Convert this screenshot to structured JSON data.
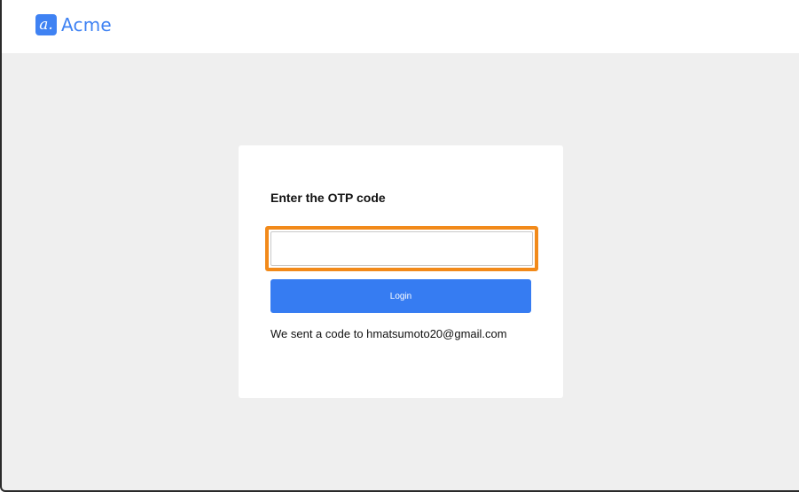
{
  "brand": {
    "logo_glyph": "a.",
    "name": "Acme",
    "color": "#3f82f3"
  },
  "otp": {
    "title": "Enter the OTP code",
    "input_value": "",
    "input_placeholder": "",
    "highlight_color": "#f28a1a"
  },
  "login_button": {
    "label": "Login",
    "color": "#367cf2"
  },
  "message": {
    "text": "We sent a code to hmatsumoto20@gmail.com"
  }
}
